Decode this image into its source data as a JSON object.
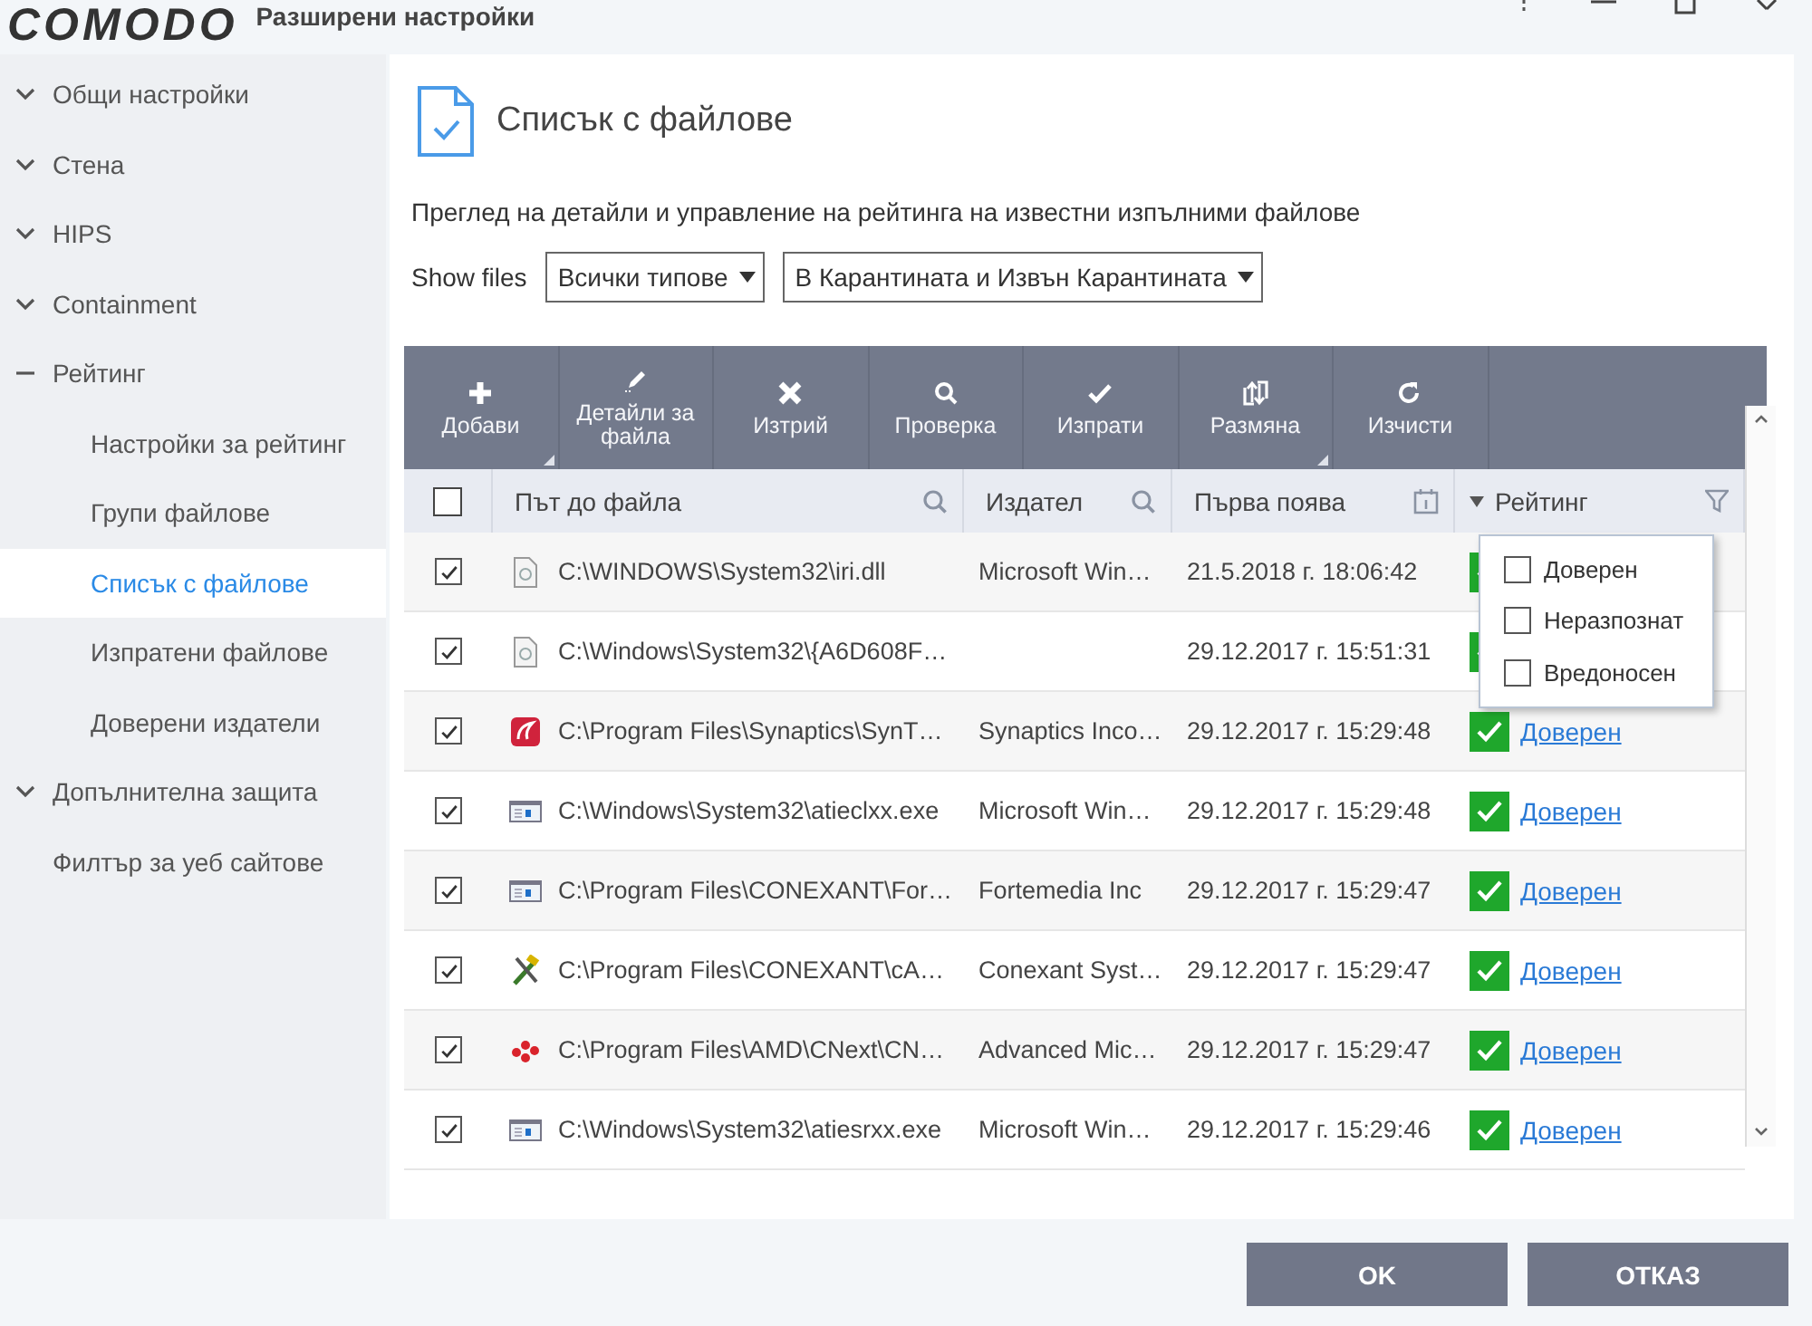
{
  "window": {
    "logo": "COMODO",
    "title": "Разширени настройки"
  },
  "sidebar": {
    "items": [
      {
        "label": "Общи настройки",
        "kind": "group",
        "expanded": false
      },
      {
        "label": "Стена",
        "kind": "group",
        "expanded": false
      },
      {
        "label": "HIPS",
        "kind": "group",
        "expanded": false
      },
      {
        "label": "Containment",
        "kind": "group",
        "expanded": false
      },
      {
        "label": "Рейтинг",
        "kind": "group",
        "expanded": true,
        "children": [
          {
            "label": "Настройки за рейтинг",
            "selected": false
          },
          {
            "label": "Групи файлове",
            "selected": false
          },
          {
            "label": "Списък с файлове",
            "selected": true
          },
          {
            "label": "Изпратени файлове",
            "selected": false
          },
          {
            "label": "Доверени издатели",
            "selected": false
          }
        ]
      },
      {
        "label": "Допълнителна защита",
        "kind": "group",
        "expanded": false
      },
      {
        "label": "Филтър за уеб сайтове",
        "kind": "link"
      }
    ]
  },
  "page": {
    "title": "Списък с файлове",
    "description": "Преглед на детайли и управление на рейтинга на известни изпълними файлове",
    "filter_label": "Show files",
    "type_select": "Всички типове",
    "quarantine_select": "В Карантината и Извън Карантината"
  },
  "toolbar": [
    {
      "label": "Добави",
      "kind": "plus",
      "has_menu": true
    },
    {
      "label": "Детайли за файла",
      "kind": "pencil",
      "has_menu": false
    },
    {
      "label": "Изтрий",
      "kind": "cross",
      "has_menu": false
    },
    {
      "label": "Проверка",
      "kind": "search",
      "has_menu": false
    },
    {
      "label": "Изпрати",
      "kind": "check",
      "has_menu": false
    },
    {
      "label": "Размяна",
      "kind": "swap",
      "has_menu": true
    },
    {
      "label": "Изчисти",
      "kind": "refresh",
      "has_menu": false
    }
  ],
  "table": {
    "header_checked": false,
    "columns": [
      "Път до файла",
      "Издател",
      "Първа поява",
      "Рейтинг"
    ],
    "rows": [
      {
        "checked": true,
        "kind": "dll",
        "path": "C:\\WINDOWS\\System32\\iri.dll",
        "publisher": "Microsoft Win…",
        "date": "21.5.2018 г. 18:06:42",
        "trusted": true
      },
      {
        "checked": true,
        "kind": "dll",
        "path": "C:\\Windows\\System32\\{A6D608F…",
        "date": "29.12.2017 г. 15:51:31",
        "trusted": true
      },
      {
        "checked": true,
        "kind": "synaptics",
        "path": "C:\\Program Files\\Synaptics\\SynT…",
        "publisher": "Synaptics Inco…",
        "date": "29.12.2017 г. 15:29:48",
        "trusted": true,
        "rating": "Доверен"
      },
      {
        "checked": true,
        "kind": "window",
        "path": "C:\\Windows\\System32\\atieclxx.exe",
        "publisher": "Microsoft Win…",
        "date": "29.12.2017 г. 15:29:48",
        "trusted": true,
        "rating": "Доверен"
      },
      {
        "checked": true,
        "kind": "window",
        "path": "C:\\Program Files\\CONEXANT\\For…",
        "publisher": "Fortemedia Inc",
        "date": "29.12.2017 г. 15:29:47",
        "trusted": true,
        "rating": "Доверен"
      },
      {
        "checked": true,
        "kind": "tools",
        "path": "C:\\Program Files\\CONEXANT\\cA…",
        "publisher": "Conexant Syst…",
        "date": "29.12.2017 г. 15:29:47",
        "trusted": true,
        "rating": "Доверен"
      },
      {
        "checked": true,
        "kind": "dots",
        "path": "C:\\Program Files\\AMD\\CNext\\CN…",
        "publisher": "Advanced Mic…",
        "date": "29.12.2017 г. 15:29:47",
        "trusted": true,
        "rating": "Доверен"
      },
      {
        "checked": true,
        "kind": "window",
        "path": "C:\\Windows\\System32\\atiesrxx.exe",
        "publisher": "Microsoft Win…",
        "date": "29.12.2017 г. 15:29:46",
        "trusted": true,
        "rating": "Доверен"
      }
    ]
  },
  "rating_filter": {
    "options": [
      {
        "label": "Доверен",
        "checked": false
      },
      {
        "label": "Неразпознат",
        "checked": false
      },
      {
        "label": "Вредоносен",
        "checked": false
      }
    ]
  },
  "buttons": [
    "OK",
    "ОТКАЗ"
  ]
}
